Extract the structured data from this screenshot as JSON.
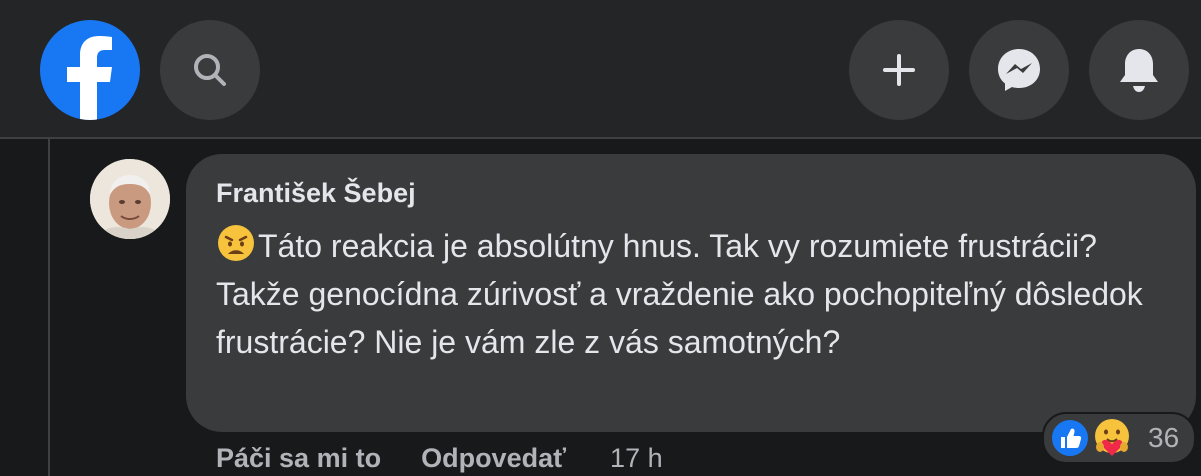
{
  "nav": {
    "logo_icon": "facebook-logo",
    "search_icon": "search-icon",
    "buttons": [
      {
        "icon": "plus-icon"
      },
      {
        "icon": "messenger-icon"
      },
      {
        "icon": "bell-icon"
      }
    ],
    "accent_color": "#1877f2"
  },
  "comment": {
    "author": "František Šebej",
    "emoji_icon": "weary-face-emoji",
    "text": "Táto reakcia je absolútny hnus. Tak vy rozumiete frustrácii? Takže genocídna zúrivosť a vraždenie ako pochopiteľný dôsledok frustrácie? Nie je vám zle z vás samotných?",
    "like_label": "Páči sa mi to",
    "reply_label": "Odpovedať",
    "time": "17 h",
    "reaction_icons": [
      "like-icon",
      "care-icon"
    ],
    "reaction_count": "36"
  }
}
